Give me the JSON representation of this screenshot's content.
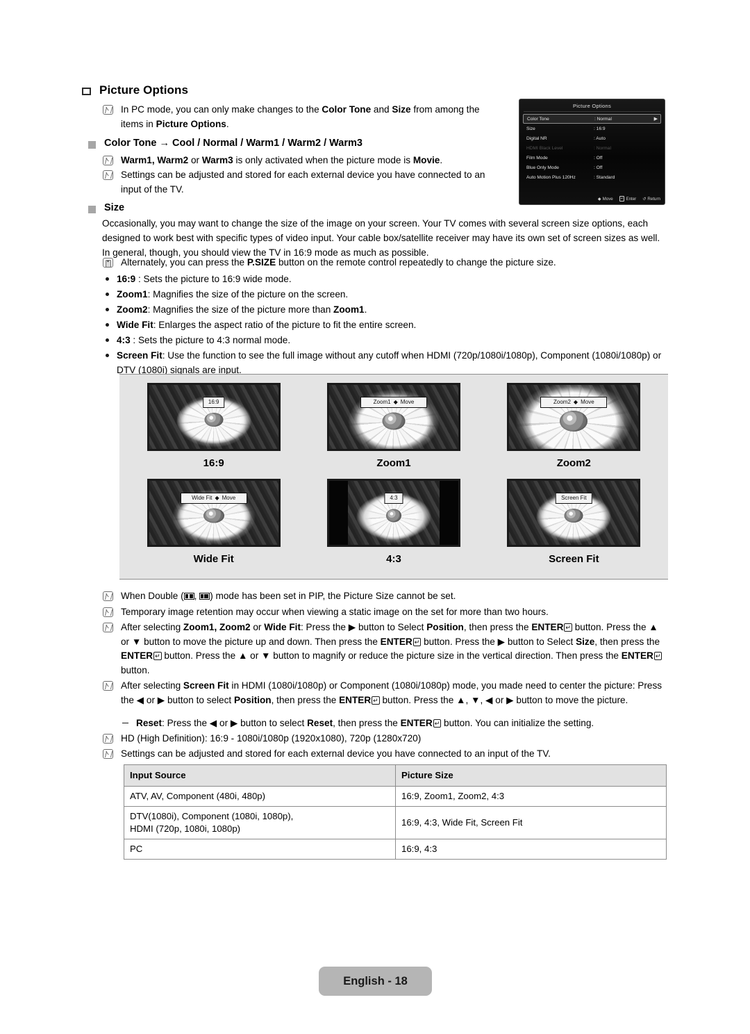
{
  "document": {
    "section_title": "Picture Options",
    "footer_page": "English - 18"
  },
  "intro_note": {
    "icon": "note-icon",
    "html": "In PC mode, you can only make changes to the <b>Color Tone</b> and <b>Size</b> from among the items in <b>Picture Options</b>."
  },
  "color_tone": {
    "heading": "Color Tone → Cool / Normal / Warm1 / Warm2 / Warm3",
    "notes": [
      "<b>Warm1, Warm2</b> or <b>Warm3</b> is only activated when the picture mode is <b>Movie</b>.",
      "Settings can be adjusted and stored for each external device you have connected to an input of the TV."
    ]
  },
  "size": {
    "heading": "Size",
    "paragraph": "Occasionally, you may want to change the size of the image on your screen. Your TV comes with several screen size options, each designed to work best with specific types of video input. Your cable box/satellite receiver may have its own set of screen sizes as well. In general, though, you should view the TV in 16:9 mode as much as possible.",
    "remote_note": "Alternately, you can press the <b>P.SIZE</b> button on the remote control repeatedly to change the picture size.",
    "bullets": [
      "<b>16:9</b> : Sets the picture to 16:9 wide mode.",
      "<b>Zoom1</b>: Magnifies the size of the picture on the screen.",
      "<b>Zoom2</b>: Magnifies the size of the picture more than <b>Zoom1</b>.",
      "<b>Wide Fit</b>: Enlarges the aspect ratio of the picture to fit the entire screen.",
      "<b>4:3</b> : Sets the picture to 4:3 normal mode.",
      "<b>Screen Fit</b>: Use the function to see the full image without any cutoff when HDMI (720p/1080i/1080p), Component (1080i/1080p) or DTV (1080i) signals are input."
    ]
  },
  "osd_menu": {
    "title": "Picture Options",
    "rows": [
      {
        "label": "Color Tone",
        "value": ": Normal",
        "selected": true,
        "dimmed": false
      },
      {
        "label": "Size",
        "value": ": 16:9",
        "selected": false,
        "dimmed": false
      },
      {
        "label": "Digital NR",
        "value": ": Auto",
        "selected": false,
        "dimmed": false
      },
      {
        "label": "HDMI Black Level",
        "value": ": Normal",
        "selected": false,
        "dimmed": true
      },
      {
        "label": "Film Mode",
        "value": ": Off",
        "selected": false,
        "dimmed": false
      },
      {
        "label": "Blue Only Mode",
        "value": ": Off",
        "selected": false,
        "dimmed": false
      },
      {
        "label": "Auto Motion Plus 120Hz",
        "value": ": Standard",
        "selected": false,
        "dimmed": false
      }
    ],
    "footer": {
      "move": "Move",
      "enter": "Enter",
      "return": "Return"
    }
  },
  "gallery": [
    {
      "caption": "16:9",
      "overlay": "16:9",
      "overlay_move": ""
    },
    {
      "caption": "Zoom1",
      "overlay": "Zoom1",
      "overlay_move": "Move"
    },
    {
      "caption": "Zoom2",
      "overlay": "Zoom2",
      "overlay_move": "Move"
    },
    {
      "caption": "Wide Fit",
      "overlay": "Wide Fit",
      "overlay_move": "Move"
    },
    {
      "caption": "4:3",
      "overlay": "4:3",
      "overlay_move": ""
    },
    {
      "caption": "Screen Fit",
      "overlay": "Screen Fit",
      "overlay_move": ""
    }
  ],
  "bottom_notes": [
    "When Double (<span class=\"pipico a\"><i></i><i></i></span>, <span class=\"pipico b\"><i></i><i></i></span>) mode has been set in PIP, the Picture Size cannot be set.",
    "Temporary image retention may occur when viewing a static image on the set for more than two hours.",
    "After selecting <b>Zoom1, Zoom2</b> or <b>Wide Fit</b>: Press the ▶ button to Select <b>Position</b>, then press the <b>ENTER</b><span class=\"ent\">↵</span> button. Press the ▲ or ▼ button to move the picture up and down. Then press the <b>ENTER</b><span class=\"ent\">↵</span> button. Press the ▶ button to Select <b>Size</b>, then press the <b>ENTER</b><span class=\"ent\">↵</span> button. Press the ▲ or ▼ button to magnify or reduce the picture size in the vertical direction. Then press the <b>ENTER</b><span class=\"ent\">↵</span> button.",
    "After selecting <b>Screen Fit</b> in HDMI (1080i/1080p) or Component (1080i/1080p) mode, you made need to center the picture: Press the ◀ or ▶ button to select <b>Position</b>, then press the <b>ENTER</b><span class=\"ent\">↵</span> button. Press the ▲, ▼, ◀ or ▶ button to move the picture.",
    "HD (High Definition): 16:9 - 1080i/1080p (1920x1080), 720p (1280x720)",
    "Settings can be adjusted and stored for each external device you have connected to an input of the TV."
  ],
  "reset_note": "<b>Reset</b>: Press the ◀ or ▶ button to select <b>Reset</b>, then press the <b>ENTER</b><span class=\"ent\">↵</span> button. You can initialize the setting.",
  "table": {
    "headers": [
      "Input Source",
      "Picture Size"
    ],
    "rows": [
      [
        "ATV, AV, Component (480i, 480p)",
        "16:9, Zoom1, Zoom2, 4:3"
      ],
      [
        "DTV(1080i), Component (1080i, 1080p),<br>HDMI (720p, 1080i, 1080p)",
        "16:9, 4:3, Wide Fit, Screen Fit"
      ],
      [
        "PC",
        "16:9, 4:3"
      ]
    ]
  }
}
